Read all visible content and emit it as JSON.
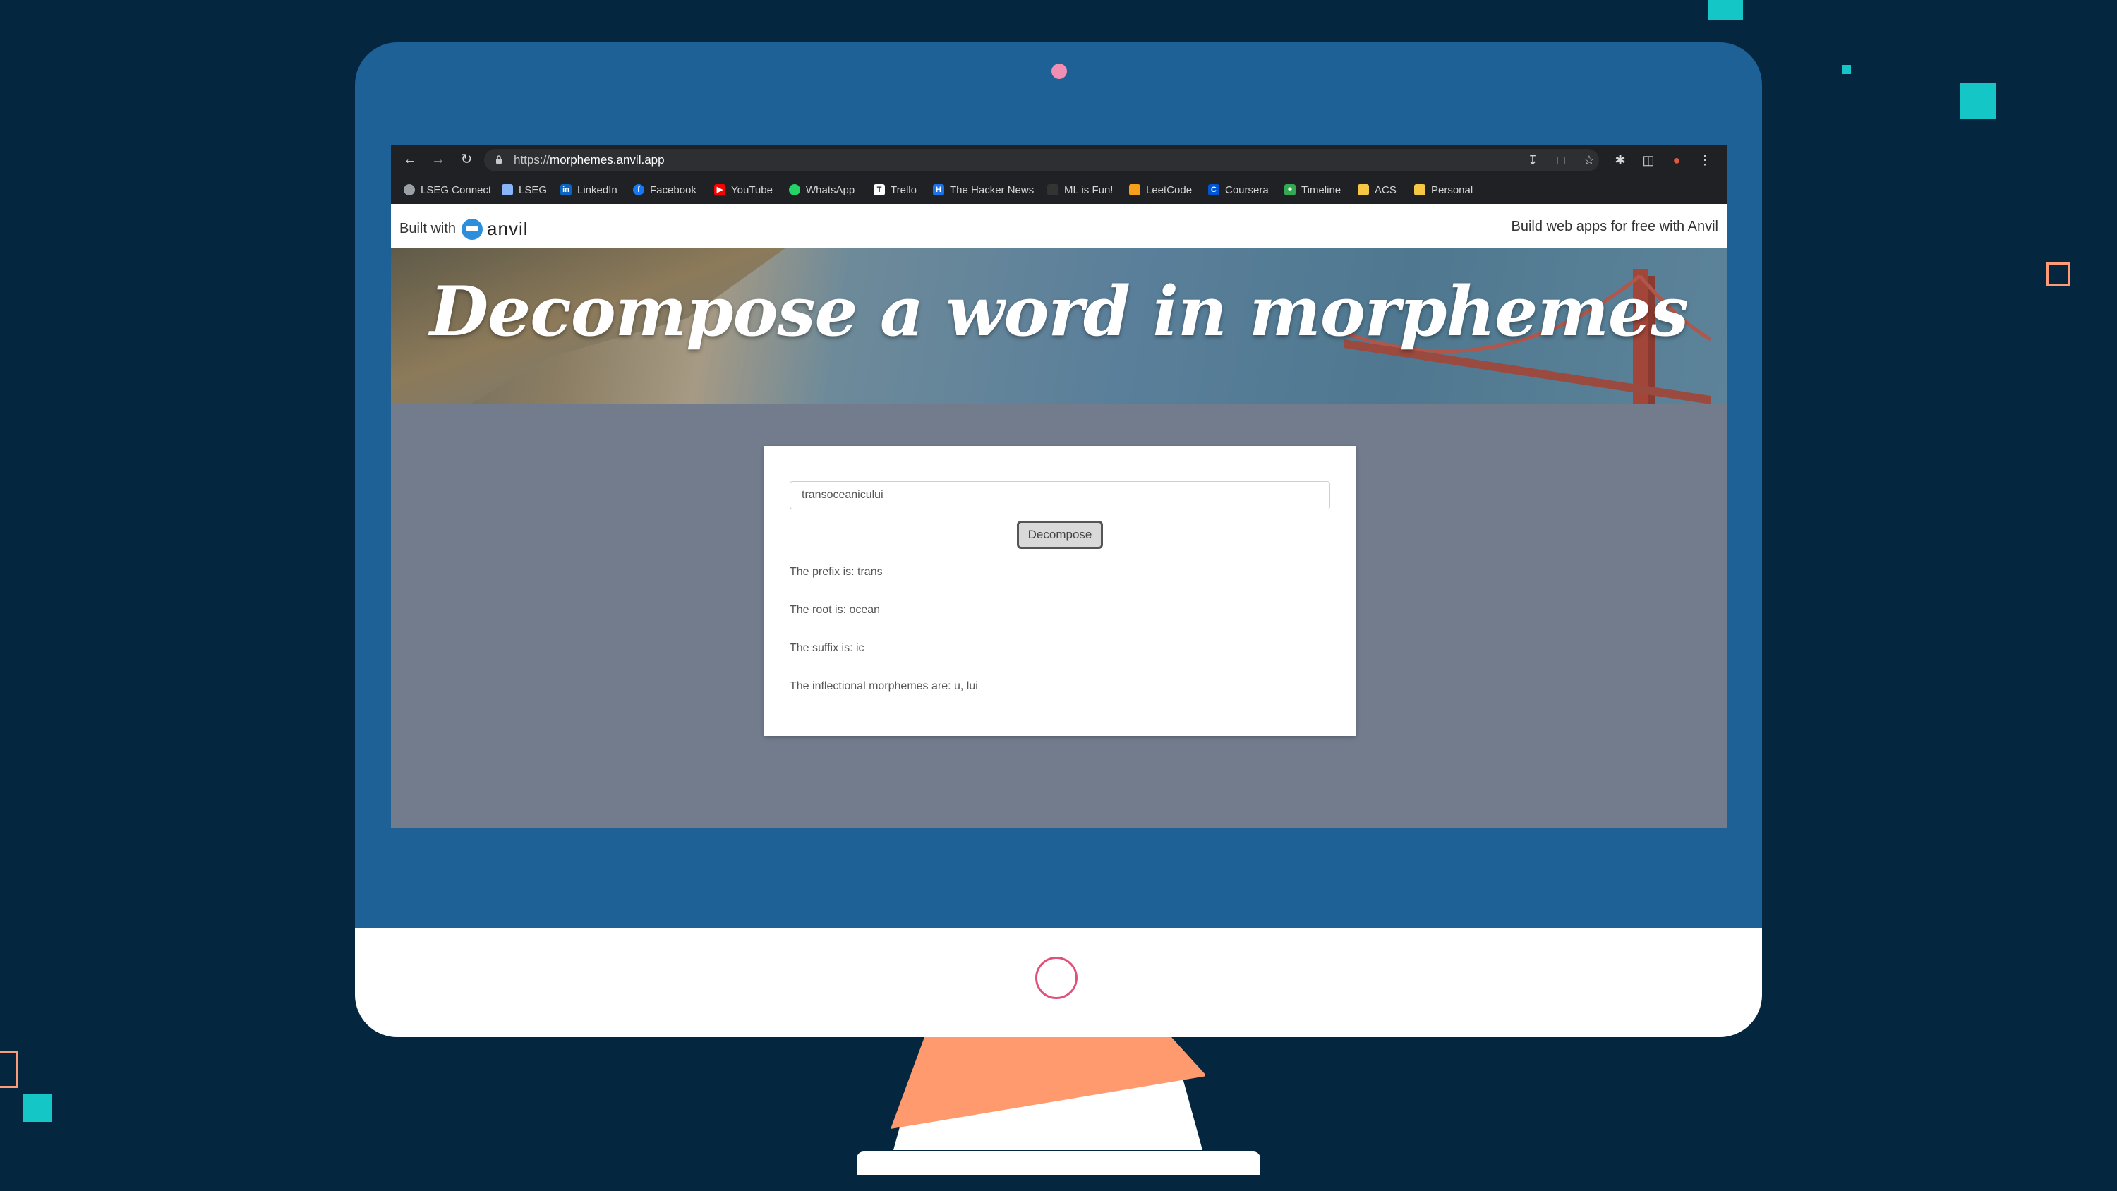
{
  "browser": {
    "url_scheme": "https://",
    "url_host": "morphemes.anvil.app",
    "bookmarks": [
      {
        "label": "LSEG Connect",
        "icon": "globe-icon",
        "color": "#9aa0a6"
      },
      {
        "label": "LSEG",
        "icon": "lseg-icon",
        "color": "#8ab4f8"
      },
      {
        "label": "LinkedIn",
        "icon": "linkedin-icon",
        "color": "#0a66c2"
      },
      {
        "label": "Facebook",
        "icon": "facebook-icon",
        "color": "#1877f2"
      },
      {
        "label": "YouTube",
        "icon": "youtube-icon",
        "color": "#ff0000"
      },
      {
        "label": "WhatsApp",
        "icon": "whatsapp-icon",
        "color": "#25d366"
      },
      {
        "label": "Trello",
        "icon": "trello-icon",
        "color": "#ffffff"
      },
      {
        "label": "The Hacker News",
        "icon": "hackernews-icon",
        "color": "#1a73e8"
      },
      {
        "label": "ML is Fun!",
        "icon": "ml-icon",
        "color": "#333333"
      },
      {
        "label": "LeetCode",
        "icon": "leetcode-icon",
        "color": "#f89f1b"
      },
      {
        "label": "Coursera",
        "icon": "coursera-icon",
        "color": "#0056d2"
      },
      {
        "label": "Timeline",
        "icon": "timeline-icon",
        "color": "#34a853"
      },
      {
        "label": "ACS",
        "icon": "folder-icon",
        "color": "#f6c744"
      },
      {
        "label": "Personal",
        "icon": "folder-icon",
        "color": "#f6c744"
      }
    ]
  },
  "anvil": {
    "built_with": "Built with",
    "brand": "anvil",
    "promo": "Build web apps for free with Anvil"
  },
  "page": {
    "title": "Decompose a word in morphemes",
    "input_value": "transoceanicului",
    "button_label": "Decompose",
    "results": [
      "The prefix is: trans",
      "The root is: ocean",
      "The suffix is: ic",
      "The inflectional morphemes are: u, lui"
    ]
  },
  "colors": {
    "background": "#04263f",
    "monitor": "#1d6196",
    "accent_teal": "#14c6c6",
    "accent_orange": "#ff9a78"
  }
}
